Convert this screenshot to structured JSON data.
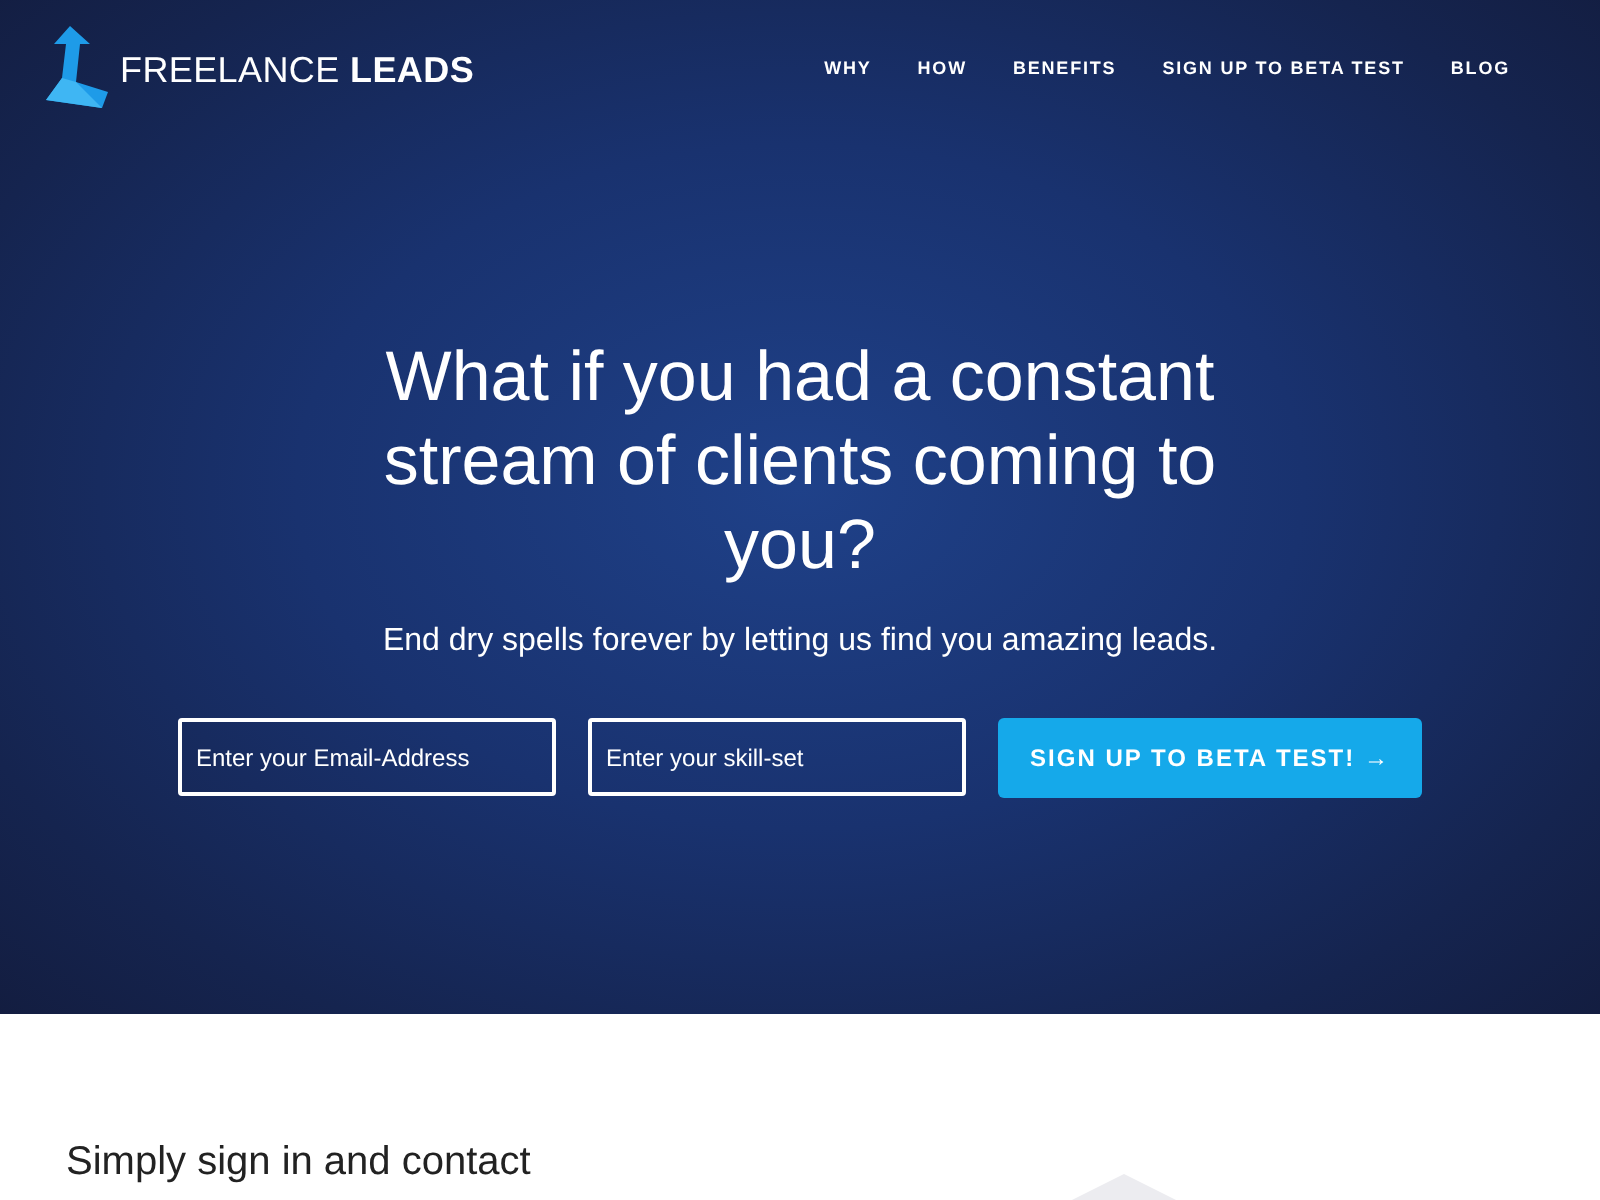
{
  "header": {
    "logo": "FREELANCE **LEADS**",
    "nav": [
      "WHY",
      "HOW",
      "BENEFITS",
      "SIGN UP TO BETA TEST",
      "BLOG"
    ]
  },
  "hero": {
    "heading": "What if you had a constant stream of clients coming to you?",
    "subheading": "End dry spells forever by letting us find you amazing leads.",
    "fields": [
      {
        "placeholder": "Enter your Email-Address"
      },
      {
        "placeholder": "Enter your skill-set"
      }
    ],
    "button": "SIGN UP TO BETA TEST! →"
  },
  "section": {
    "heading": "Simply sign in and contact"
  }
}
